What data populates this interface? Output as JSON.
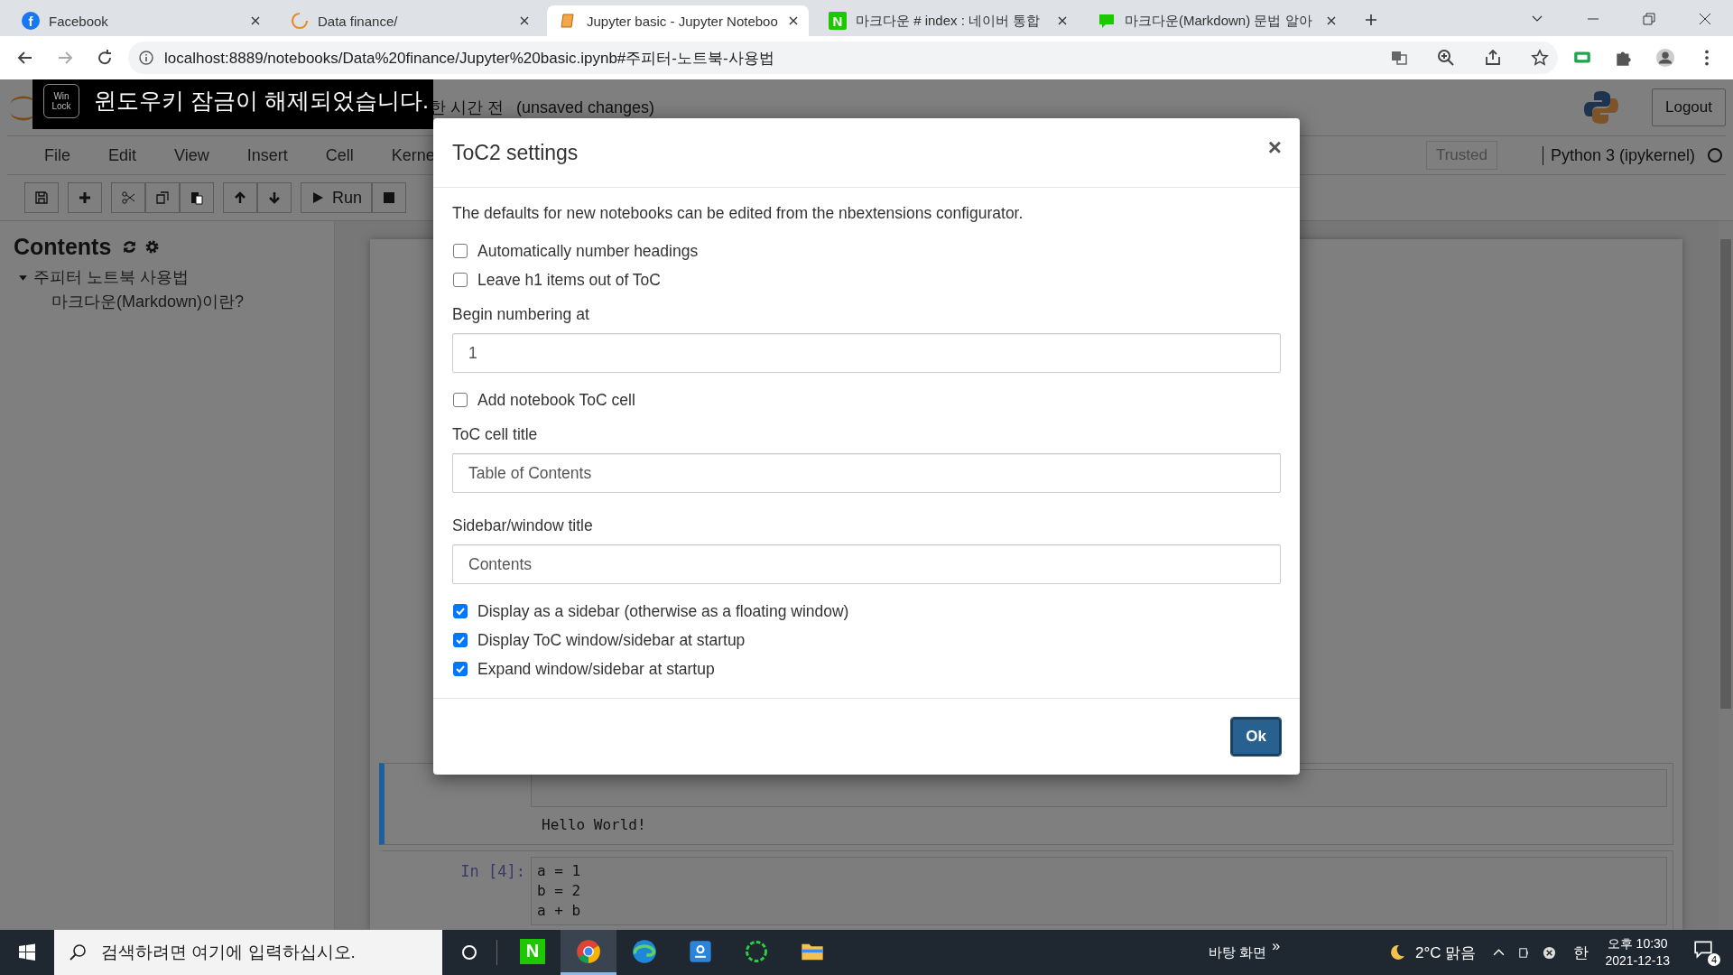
{
  "browser": {
    "tabs": [
      {
        "kind": "facebook",
        "icon_text": "f",
        "title": "Facebook",
        "selected": false
      },
      {
        "kind": "spinner",
        "title": "Data finance/",
        "selected": false
      },
      {
        "kind": "notebook",
        "title": "Jupyter basic - Jupyter Noteboo",
        "selected": true
      },
      {
        "kind": "naver",
        "icon_text": "N",
        "title": "마크다운 # index : 네이버 통합",
        "selected": false
      },
      {
        "kind": "blog",
        "title": "마크다운(Markdown) 문법 알아",
        "selected": false
      }
    ],
    "url": "localhost:8889/notebooks/Data%20finance/Jupyter%20basic.ipynb#주피터-노트북-사용법"
  },
  "notice": {
    "logo_top": "Win",
    "logo_bottom": "Lock",
    "message": "윈도우키 잠금이 해제되었습니다."
  },
  "jupyter": {
    "save_status": "한 시간 전",
    "unsaved": "(unsaved changes)",
    "logout": "Logout",
    "menu": [
      "File",
      "Edit",
      "View",
      "Insert",
      "Cell",
      "Kerne"
    ],
    "trusted": "Trusted",
    "kernel": "Python 3 (ipykernel)",
    "run": "Run",
    "sidebar": {
      "title": "Contents",
      "items": [
        {
          "text": "주피터 노트북 사용법",
          "expanded": true,
          "children": [
            {
              "text": "마크다운(Markdown)이란?"
            }
          ]
        }
      ]
    },
    "cells": [
      {
        "selected": true,
        "output": "Hello World!"
      },
      {
        "selected": false,
        "prompt": "In [4]:",
        "code": [
          "a = 1",
          "b = 2",
          "a + b"
        ]
      }
    ]
  },
  "dialog": {
    "title": "ToC2 settings",
    "close": "×",
    "description": "The defaults for new notebooks can be edited from the nbextensions configurator.",
    "fields": [
      {
        "kind": "checkbox",
        "label": "Automatically number headings",
        "checked": false
      },
      {
        "kind": "checkbox",
        "label": "Leave h1 items out of ToC",
        "checked": false
      },
      {
        "kind": "text",
        "label": "Begin numbering at",
        "value": "1"
      },
      {
        "kind": "checkbox",
        "label": "Add notebook ToC cell",
        "checked": false
      },
      {
        "kind": "text",
        "label": "ToC cell title",
        "value": "Table of Contents"
      },
      {
        "kind": "text",
        "label": "Sidebar/window title",
        "value": "Contents"
      },
      {
        "kind": "checkbox",
        "label": "Display as a sidebar (otherwise as a floating window)",
        "checked": true
      },
      {
        "kind": "checkbox",
        "label": "Display ToC window/sidebar at startup",
        "checked": true
      },
      {
        "kind": "checkbox",
        "label": "Expand window/sidebar at startup",
        "checked": true
      }
    ],
    "ok": "Ok"
  },
  "taskbar": {
    "search_placeholder": "검색하려면 여기에 입력하십시오.",
    "apps": [
      {
        "kind": "naver",
        "label": "N",
        "selected": false
      },
      {
        "kind": "chrome",
        "selected": true
      },
      {
        "kind": "edge",
        "selected": false
      },
      {
        "kind": "blue-app",
        "selected": false
      },
      {
        "kind": "spinner",
        "selected": false
      },
      {
        "kind": "folder",
        "selected": false
      }
    ],
    "desktop": "바탕 화면",
    "more": "»",
    "weather": "2°C 맑음",
    "ime": "한",
    "time": "오후 10:30",
    "date": "2021-12-13",
    "notifications": "4"
  }
}
